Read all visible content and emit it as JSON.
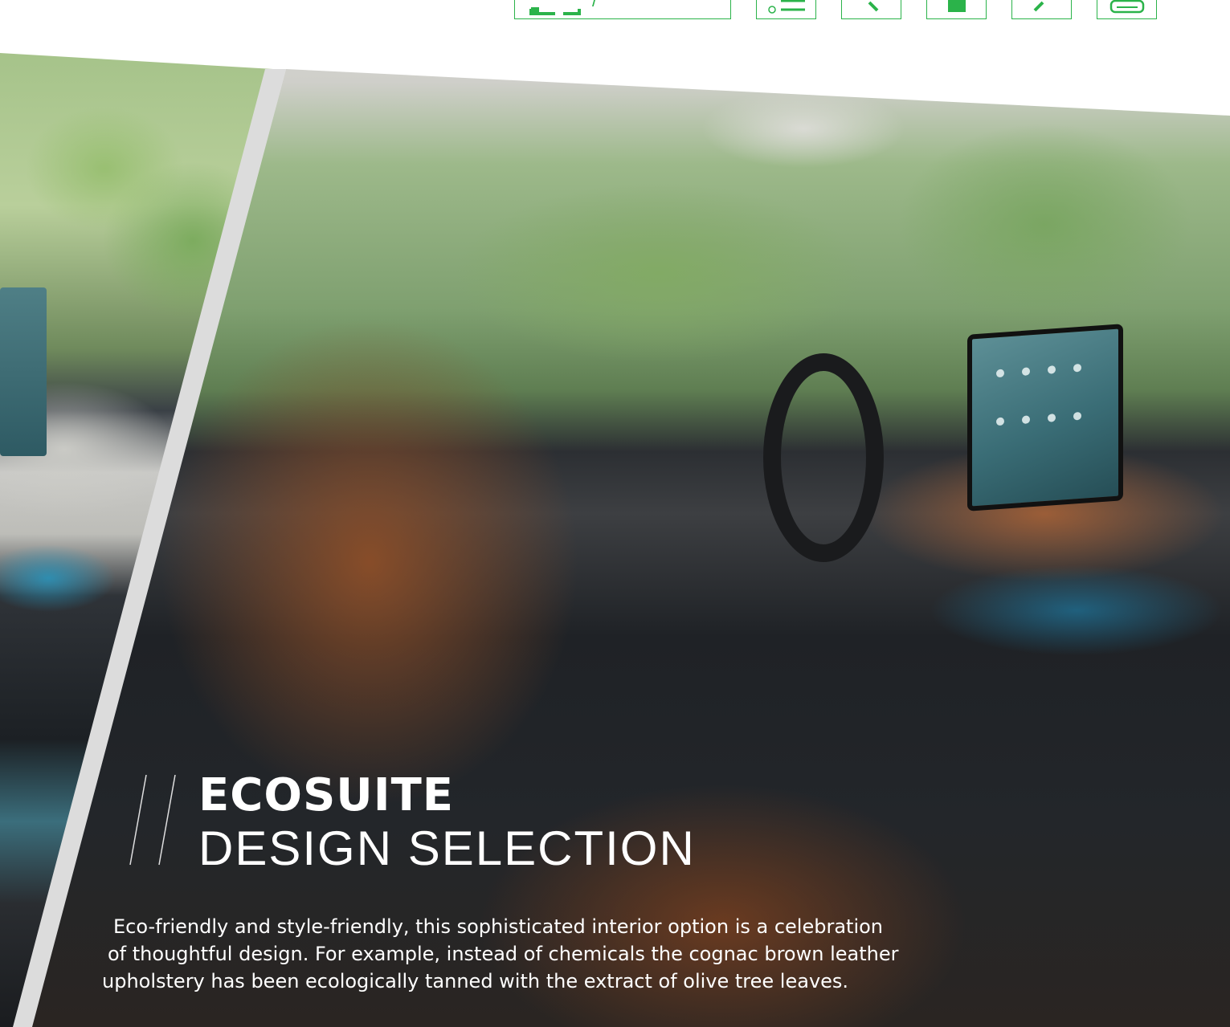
{
  "toolbar": {
    "nav_label": "/",
    "buttons": [
      {
        "name": "contents-button",
        "icon": "list-icon"
      },
      {
        "name": "back-button",
        "icon": "arrow-left-icon"
      },
      {
        "name": "bookmark-button",
        "icon": "bookmark-icon"
      },
      {
        "name": "share-button",
        "icon": "share-icon"
      },
      {
        "name": "print-button",
        "icon": "printer-icon"
      }
    ],
    "accent_color": "#2bb34a"
  },
  "headline": {
    "title": "ECOSUITE",
    "subtitle": "DESIGN SELECTION"
  },
  "body": {
    "line1": "Eco-friendly and style-friendly, this sophisticated interior option is a celebration",
    "line2": "of thoughtful design. For example, instead of chemicals the cognac brown leather",
    "line3": "upholstery has been ecologically tanned with the extract of olive tree leaves."
  }
}
